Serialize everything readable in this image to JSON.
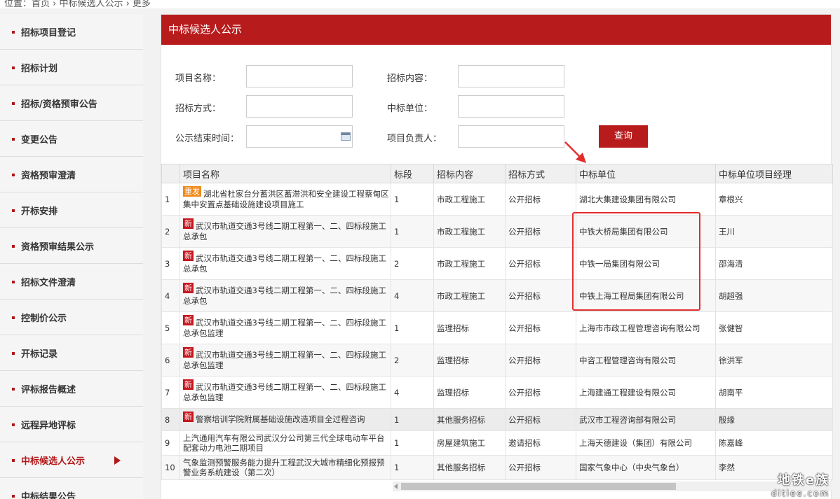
{
  "breadcrumb": "位置：首页 › 中标候选人公示 › 更多",
  "sidebar": {
    "items": [
      {
        "label": "招标项目登记"
      },
      {
        "label": "招标计划"
      },
      {
        "label": "招标/资格预审公告"
      },
      {
        "label": "变更公告"
      },
      {
        "label": "资格预审澄清"
      },
      {
        "label": "开标安排"
      },
      {
        "label": "资格预审结果公示"
      },
      {
        "label": "招标文件澄清"
      },
      {
        "label": "控制价公示"
      },
      {
        "label": "开标记录"
      },
      {
        "label": "评标报告概述"
      },
      {
        "label": "远程异地评标"
      },
      {
        "label": "中标候选人公示"
      },
      {
        "label": "中标结果公告"
      }
    ],
    "active_index": 12
  },
  "panel": {
    "title": "中标候选人公示"
  },
  "form": {
    "project_name_label": "项目名称：",
    "content_label": "招标内容：",
    "method_label": "招标方式：",
    "winner_label": "中标单位：",
    "end_time_label": "公示结束时间：",
    "manager_label": "项目负责人：",
    "query_button": "查询"
  },
  "table": {
    "headers": [
      "项目名称",
      "标段",
      "招标内容",
      "招标方式",
      "中标单位",
      "中标单位项目经理"
    ],
    "rows": [
      {
        "no": "1",
        "tag": "重发",
        "name": "湖北省杜家台分蓄洪区蓄滞洪和安全建设工程蔡甸区集中安置点基础设施建设项目施工",
        "section": "1",
        "content": "市政工程施工",
        "method": "公开招标",
        "winner": "湖北大集建设集团有限公司",
        "manager": "章根兴"
      },
      {
        "no": "2",
        "tag": "新",
        "name": "武汉市轨道交通3号线二期工程第一、二、四标段施工总承包",
        "section": "1",
        "content": "市政工程施工",
        "method": "公开招标",
        "winner": "中铁大桥局集团有限公司",
        "manager": "王川"
      },
      {
        "no": "3",
        "tag": "新",
        "name": "武汉市轨道交通3号线二期工程第一、二、四标段施工总承包",
        "section": "2",
        "content": "市政工程施工",
        "method": "公开招标",
        "winner": "中铁一局集团有限公司",
        "manager": "邵海清"
      },
      {
        "no": "4",
        "tag": "新",
        "name": "武汉市轨道交通3号线二期工程第一、二、四标段施工总承包",
        "section": "4",
        "content": "市政工程施工",
        "method": "公开招标",
        "winner": "中铁上海工程局集团有限公司",
        "manager": "胡超强"
      },
      {
        "no": "5",
        "tag": "新",
        "name": "武汉市轨道交通3号线二期工程第一、二、四标段施工总承包监理",
        "section": "1",
        "content": "监理招标",
        "method": "公开招标",
        "winner": "上海市市政工程管理咨询有限公司",
        "manager": "张健智"
      },
      {
        "no": "6",
        "tag": "新",
        "name": "武汉市轨道交通3号线二期工程第一、二、四标段施工总承包监理",
        "section": "2",
        "content": "监理招标",
        "method": "公开招标",
        "winner": "中咨工程管理咨询有限公司",
        "manager": "徐洪军"
      },
      {
        "no": "7",
        "tag": "新",
        "name": "武汉市轨道交通3号线二期工程第一、二、四标段施工总承包监理",
        "section": "4",
        "content": "监理招标",
        "method": "公开招标",
        "winner": "上海建通工程建设有限公司",
        "manager": "胡南平"
      },
      {
        "no": "8",
        "tag": "新",
        "name": "警察培训学院附属基础设施改造项目全过程咨询",
        "section": "1",
        "content": "其他服务招标",
        "method": "公开招标",
        "winner": "武汉市工程咨询部有限公司",
        "manager": "殷缘"
      },
      {
        "no": "9",
        "tag": "",
        "name": "上汽通用汽车有限公司武汉分公司第三代全球电动车平台配套动力电池二期项目",
        "section": "1",
        "content": "房屋建筑施工",
        "method": "邀请招标",
        "winner": "上海天德建设（集团）有限公司",
        "manager": "陈嘉峰"
      },
      {
        "no": "10",
        "tag": "",
        "name": "气象监测预警服务能力提升工程武汉大城市精细化预报预警业务系统建设（第二次）",
        "section": "1",
        "content": "其他服务招标",
        "method": "公开招标",
        "winner": "国家气象中心（中央气象台）",
        "manager": "李然"
      }
    ]
  },
  "watermark": {
    "line1": "地铁e族",
    "line2": "ditiee.com"
  },
  "colors": {
    "brand_red": "#b81b1c",
    "new_tag": "#c8161d",
    "reissue_tag": "#ef8a1c",
    "highlight_box": "#e32d2d"
  }
}
